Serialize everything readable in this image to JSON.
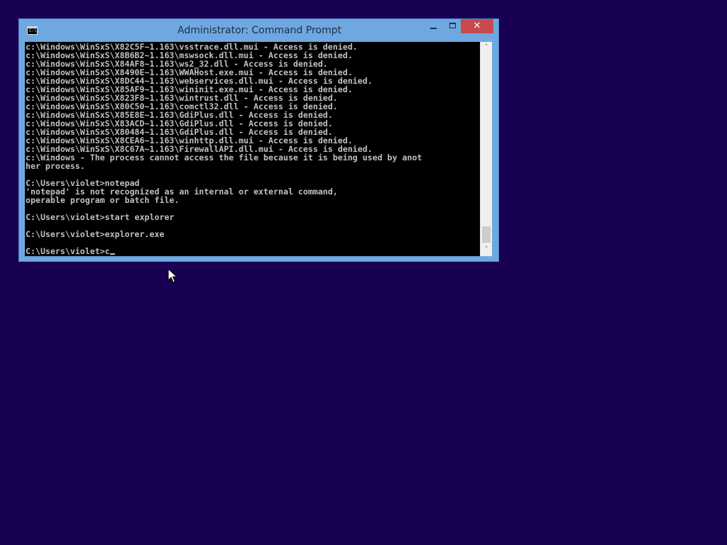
{
  "window": {
    "title": "Administrator: Command Prompt",
    "icon_text": "C:\\.",
    "controls": {
      "minimize": "minimize",
      "maximize": "maximize",
      "close": "✕"
    }
  },
  "console": {
    "lines": [
      "c:\\Windows\\WinSxS\\X82C5F~1.163\\vsstrace.dll.mui - Access is denied.",
      "c:\\Windows\\WinSxS\\X8B6B2~1.163\\mswsock.dll.mui - Access is denied.",
      "c:\\Windows\\WinSxS\\X84AF8~1.163\\ws2_32.dll - Access is denied.",
      "c:\\Windows\\WinSxS\\X8490E~1.163\\WWAHost.exe.mui - Access is denied.",
      "c:\\Windows\\WinSxS\\X8DC44~1.163\\webservices.dll.mui - Access is denied.",
      "c:\\Windows\\WinSxS\\X85AF9~1.163\\wininit.exe.mui - Access is denied.",
      "c:\\Windows\\WinSxS\\X823F8~1.163\\wintrust.dll - Access is denied.",
      "c:\\Windows\\WinSxS\\X80C50~1.163\\comctl32.dll - Access is denied.",
      "c:\\Windows\\WinSxS\\X85E8E~1.163\\GdiPlus.dll - Access is denied.",
      "c:\\Windows\\WinSxS\\X83ACD~1.163\\GdiPlus.dll - Access is denied.",
      "c:\\Windows\\WinSxS\\X80484~1.163\\GdiPlus.dll - Access is denied.",
      "c:\\Windows\\WinSxS\\X8CEA6~1.163\\winhttp.dll.mui - Access is denied.",
      "c:\\Windows\\WinSxS\\X8C67A~1.163\\FirewallAPI.dll.mui - Access is denied.",
      "c:\\Windows - The process cannot access the file because it is being used by anot",
      "her process.",
      "",
      "C:\\Users\\violet>notepad",
      "'notepad' is not recognized as an internal or external command,",
      "operable program or batch file.",
      "",
      "C:\\Users\\violet>start explorer",
      "",
      "C:\\Users\\violet>explorer.exe",
      ""
    ],
    "prompt_line": "C:\\Users\\violet>c"
  },
  "scrollbar": {
    "up_arrow": "˄",
    "down_arrow": "˅"
  },
  "colors": {
    "desktop": "#180052",
    "window_frame": "#6fa8e0",
    "close_button": "#c74b4b",
    "console_bg": "#000000",
    "console_text": "#c0c0c0"
  }
}
